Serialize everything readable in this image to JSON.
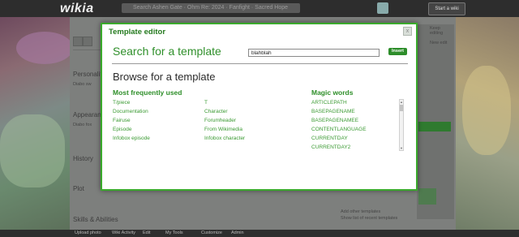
{
  "site": {
    "logo": "wikia",
    "search_placeholder": "Search Ashen Gate · Ohm Re: 2024 · Fanfight · Sacred Hope",
    "start_wiki_label": "Start a wiki"
  },
  "editor_bg": {
    "sections": [
      "Personality",
      "Appearance",
      "History",
      "Plot",
      "Skills & Abilities"
    ],
    "rail_right": [
      "Keep editing",
      "New edit",
      "Add other templates",
      "Show list of recent templates"
    ]
  },
  "footer": {
    "items": [
      "Upload photo",
      "Wiki Activity",
      "Edit",
      "My Tools",
      "Customize",
      "Admin"
    ]
  },
  "modal": {
    "title": "Template editor",
    "close_label": "x",
    "search_heading": "Search for a template",
    "search_value": "blahblah",
    "insert_label": "Insert",
    "browse_heading": "Browse for a template",
    "most_used_heading": "Most frequently used",
    "most_used_col1": [
      "T/piece",
      "Documentation",
      "Fairuse",
      "Episode",
      "Infobox episode"
    ],
    "most_used_col2": [
      "T",
      "Character",
      "Forumheader",
      "From Wikimedia",
      "Infobox character"
    ],
    "magic_heading": "Magic words",
    "magic_words": [
      "ARTICLEPATH",
      "BASEPAGENAME",
      "BASEPAGENAMEE",
      "CONTENTLANGUAGE",
      "CURRENTDAY",
      "CURRENTDAY2"
    ]
  }
}
